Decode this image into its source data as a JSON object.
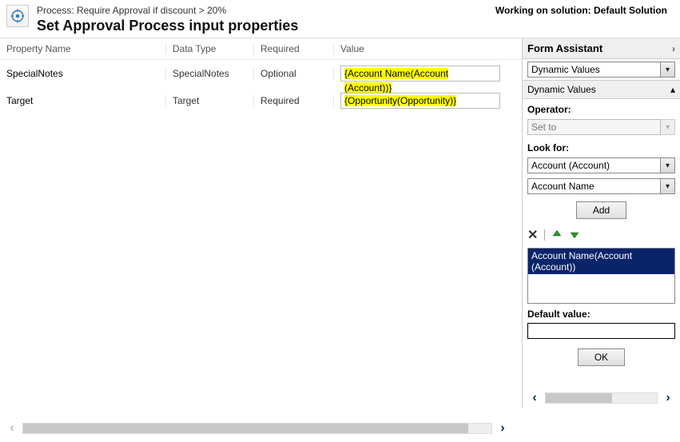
{
  "header": {
    "process_label": "Process: Require Approval if discount > 20%",
    "title": "Set Approval Process input properties",
    "solution": "Working on solution: Default Solution"
  },
  "columns": {
    "name": "Property Name",
    "type": "Data Type",
    "required": "Required",
    "value": "Value"
  },
  "rows": [
    {
      "name": "SpecialNotes",
      "type": "SpecialNotes",
      "required": "Optional",
      "value": "{Account Name(Account (Account))}"
    },
    {
      "name": "Target",
      "type": "Target",
      "required": "Required",
      "value": "{Opportunity(Opportunity)}"
    }
  ],
  "assistant": {
    "title": "Form Assistant",
    "dynamic_values_option": "Dynamic Values",
    "dynamic_values_section": "Dynamic Values",
    "operator_label": "Operator:",
    "operator_value": "Set to",
    "lookfor_label": "Look for:",
    "lookfor_entity": "Account (Account)",
    "lookfor_attr": "Account Name",
    "add_label": "Add",
    "list_item": "Account Name(Account (Account))",
    "default_label": "Default value:",
    "default_value": "",
    "ok_label": "OK"
  }
}
